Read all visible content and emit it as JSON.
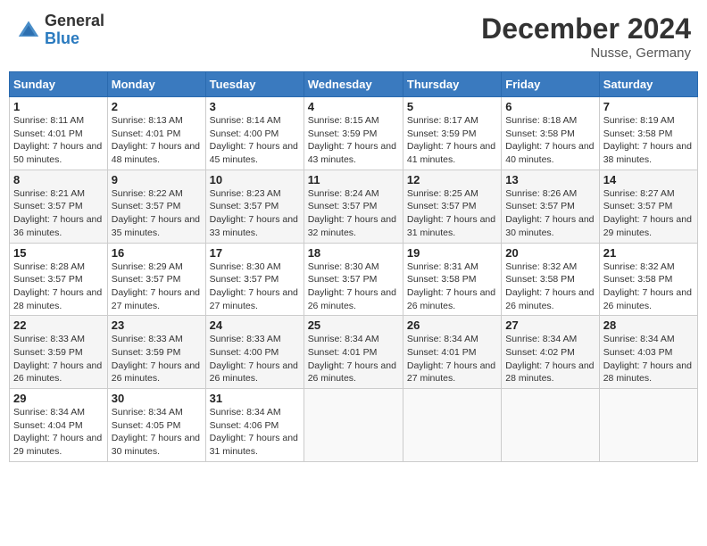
{
  "header": {
    "logo_general": "General",
    "logo_blue": "Blue",
    "month": "December 2024",
    "location": "Nusse, Germany"
  },
  "weekdays": [
    "Sunday",
    "Monday",
    "Tuesday",
    "Wednesday",
    "Thursday",
    "Friday",
    "Saturday"
  ],
  "weeks": [
    [
      {
        "day": "1",
        "sunrise": "8:11 AM",
        "sunset": "4:01 PM",
        "daylight": "7 hours and 50 minutes."
      },
      {
        "day": "2",
        "sunrise": "8:13 AM",
        "sunset": "4:01 PM",
        "daylight": "7 hours and 48 minutes."
      },
      {
        "day": "3",
        "sunrise": "8:14 AM",
        "sunset": "4:00 PM",
        "daylight": "7 hours and 45 minutes."
      },
      {
        "day": "4",
        "sunrise": "8:15 AM",
        "sunset": "3:59 PM",
        "daylight": "7 hours and 43 minutes."
      },
      {
        "day": "5",
        "sunrise": "8:17 AM",
        "sunset": "3:59 PM",
        "daylight": "7 hours and 41 minutes."
      },
      {
        "day": "6",
        "sunrise": "8:18 AM",
        "sunset": "3:58 PM",
        "daylight": "7 hours and 40 minutes."
      },
      {
        "day": "7",
        "sunrise": "8:19 AM",
        "sunset": "3:58 PM",
        "daylight": "7 hours and 38 minutes."
      }
    ],
    [
      {
        "day": "8",
        "sunrise": "8:21 AM",
        "sunset": "3:57 PM",
        "daylight": "7 hours and 36 minutes."
      },
      {
        "day": "9",
        "sunrise": "8:22 AM",
        "sunset": "3:57 PM",
        "daylight": "7 hours and 35 minutes."
      },
      {
        "day": "10",
        "sunrise": "8:23 AM",
        "sunset": "3:57 PM",
        "daylight": "7 hours and 33 minutes."
      },
      {
        "day": "11",
        "sunrise": "8:24 AM",
        "sunset": "3:57 PM",
        "daylight": "7 hours and 32 minutes."
      },
      {
        "day": "12",
        "sunrise": "8:25 AM",
        "sunset": "3:57 PM",
        "daylight": "7 hours and 31 minutes."
      },
      {
        "day": "13",
        "sunrise": "8:26 AM",
        "sunset": "3:57 PM",
        "daylight": "7 hours and 30 minutes."
      },
      {
        "day": "14",
        "sunrise": "8:27 AM",
        "sunset": "3:57 PM",
        "daylight": "7 hours and 29 minutes."
      }
    ],
    [
      {
        "day": "15",
        "sunrise": "8:28 AM",
        "sunset": "3:57 PM",
        "daylight": "7 hours and 28 minutes."
      },
      {
        "day": "16",
        "sunrise": "8:29 AM",
        "sunset": "3:57 PM",
        "daylight": "7 hours and 27 minutes."
      },
      {
        "day": "17",
        "sunrise": "8:30 AM",
        "sunset": "3:57 PM",
        "daylight": "7 hours and 27 minutes."
      },
      {
        "day": "18",
        "sunrise": "8:30 AM",
        "sunset": "3:57 PM",
        "daylight": "7 hours and 26 minutes."
      },
      {
        "day": "19",
        "sunrise": "8:31 AM",
        "sunset": "3:58 PM",
        "daylight": "7 hours and 26 minutes."
      },
      {
        "day": "20",
        "sunrise": "8:32 AM",
        "sunset": "3:58 PM",
        "daylight": "7 hours and 26 minutes."
      },
      {
        "day": "21",
        "sunrise": "8:32 AM",
        "sunset": "3:58 PM",
        "daylight": "7 hours and 26 minutes."
      }
    ],
    [
      {
        "day": "22",
        "sunrise": "8:33 AM",
        "sunset": "3:59 PM",
        "daylight": "7 hours and 26 minutes."
      },
      {
        "day": "23",
        "sunrise": "8:33 AM",
        "sunset": "3:59 PM",
        "daylight": "7 hours and 26 minutes."
      },
      {
        "day": "24",
        "sunrise": "8:33 AM",
        "sunset": "4:00 PM",
        "daylight": "7 hours and 26 minutes."
      },
      {
        "day": "25",
        "sunrise": "8:34 AM",
        "sunset": "4:01 PM",
        "daylight": "7 hours and 26 minutes."
      },
      {
        "day": "26",
        "sunrise": "8:34 AM",
        "sunset": "4:01 PM",
        "daylight": "7 hours and 27 minutes."
      },
      {
        "day": "27",
        "sunrise": "8:34 AM",
        "sunset": "4:02 PM",
        "daylight": "7 hours and 28 minutes."
      },
      {
        "day": "28",
        "sunrise": "8:34 AM",
        "sunset": "4:03 PM",
        "daylight": "7 hours and 28 minutes."
      }
    ],
    [
      {
        "day": "29",
        "sunrise": "8:34 AM",
        "sunset": "4:04 PM",
        "daylight": "7 hours and 29 minutes."
      },
      {
        "day": "30",
        "sunrise": "8:34 AM",
        "sunset": "4:05 PM",
        "daylight": "7 hours and 30 minutes."
      },
      {
        "day": "31",
        "sunrise": "8:34 AM",
        "sunset": "4:06 PM",
        "daylight": "7 hours and 31 minutes."
      },
      null,
      null,
      null,
      null
    ]
  ]
}
